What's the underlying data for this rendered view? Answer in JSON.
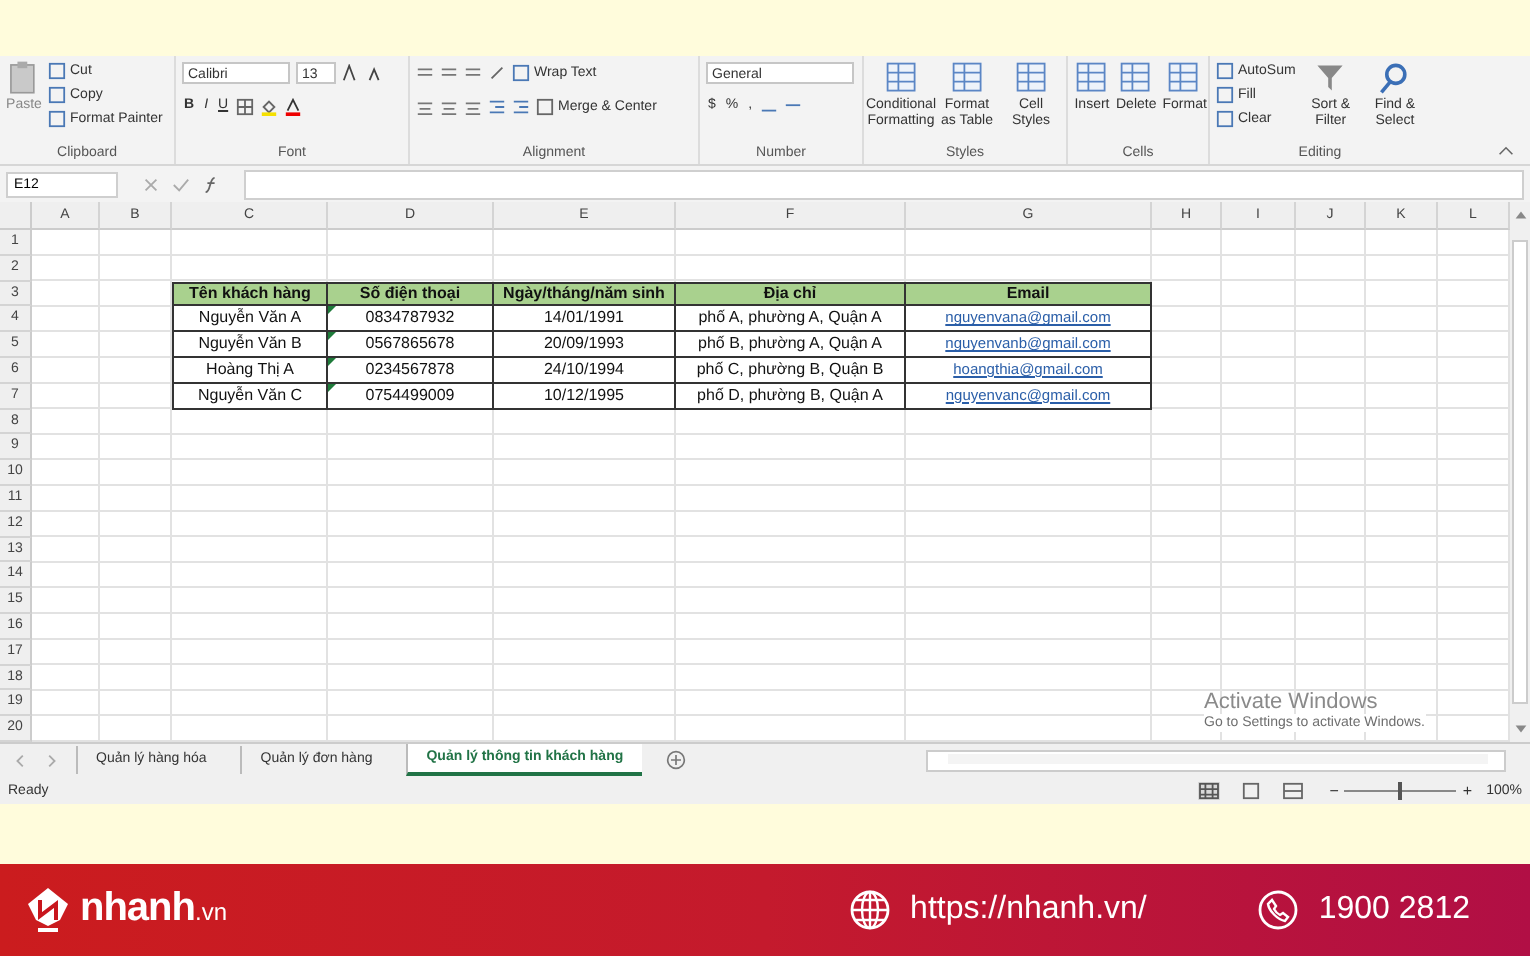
{
  "ribbon": {
    "groups": [
      {
        "kind": "clipboard",
        "label": "Clipboard",
        "paste": "Paste",
        "items": [
          "Cut",
          "Copy",
          "Format Painter"
        ]
      },
      {
        "kind": "font",
        "label": "Font",
        "font_name": "Calibri",
        "font_size": "13",
        "styles": [
          "B",
          "I",
          "U"
        ]
      },
      {
        "kind": "alignment",
        "label": "Alignment",
        "items": [
          "Wrap Text",
          "Merge & Center"
        ]
      },
      {
        "kind": "number",
        "label": "Number",
        "format": "General",
        "symbols": [
          "$",
          "%",
          ","
        ]
      },
      {
        "kind": "large",
        "label": "Styles",
        "items": [
          "Conditional Formatting",
          "Format as Table",
          "Cell Styles"
        ]
      },
      {
        "kind": "large",
        "label": "Cells",
        "items": [
          "Insert",
          "Delete",
          "Format"
        ]
      },
      {
        "kind": "editing",
        "label": "Editing",
        "items": [
          "AutoSum",
          "Fill",
          "Clear"
        ],
        "large": [
          "Sort & Filter",
          "Find & Select"
        ]
      }
    ]
  },
  "name_box": "E12",
  "columns": [
    "A",
    "B",
    "C",
    "D",
    "E",
    "F",
    "G",
    "H",
    "I",
    "J",
    "K",
    "L"
  ],
  "rows": [
    "1",
    "2",
    "3",
    "4",
    "5",
    "6",
    "7",
    "8",
    "9",
    "10",
    "11",
    "12",
    "13",
    "14",
    "15",
    "16",
    "17",
    "18",
    "19",
    "20"
  ],
  "table": {
    "header": [
      "Tên khách hàng",
      "Số điện thoại",
      "Ngày/tháng/năm sinh",
      "Địa chỉ",
      "Email"
    ],
    "rows": [
      {
        "cells": [
          "Nguyễn Văn A",
          "0834787932",
          "14/01/1991",
          "phố A, phường A, Quận A",
          "nguyenvana@gmail.com"
        ],
        "number_as_text": true
      },
      {
        "cells": [
          "Nguyễn Văn B",
          "0567865678",
          "20/09/1993",
          "phố B, phường A, Quận A",
          "nguyenvanb@gmail.com"
        ],
        "number_as_text": true
      },
      {
        "cells": [
          "Hoàng Thị A",
          "0234567878",
          "24/10/1994",
          "phố C, phường B, Quận B",
          "hoangthia@gmail.com"
        ],
        "number_as_text": true
      },
      {
        "cells": [
          "Nguyễn Văn C",
          "0754499009",
          "10/12/1995",
          "phố D, phường B, Quận A",
          "nguyenvanc@gmail.com"
        ],
        "number_as_text": true
      }
    ]
  },
  "sheet_tabs": [
    {
      "label": "Quản lý hàng hóa",
      "selected": false
    },
    {
      "label": "Quản lý đơn hàng",
      "selected": false
    },
    {
      "label": "Quản lý thông tin khách hàng",
      "selected": true
    }
  ],
  "overlay": {
    "title": "Activate Windows",
    "subtitle": "Go to Settings to activate Windows."
  },
  "status_bar": {
    "status": "Ready",
    "zoom": "100%",
    "zoom_out": "−",
    "zoom_in": "+",
    "zoom_slider": {
      "level": 0.5
    }
  },
  "footer": {
    "brand": "nhanh",
    "brand_suffix": ".vn",
    "website": "https://nhanh.vn/",
    "phone": "1900 2812"
  }
}
